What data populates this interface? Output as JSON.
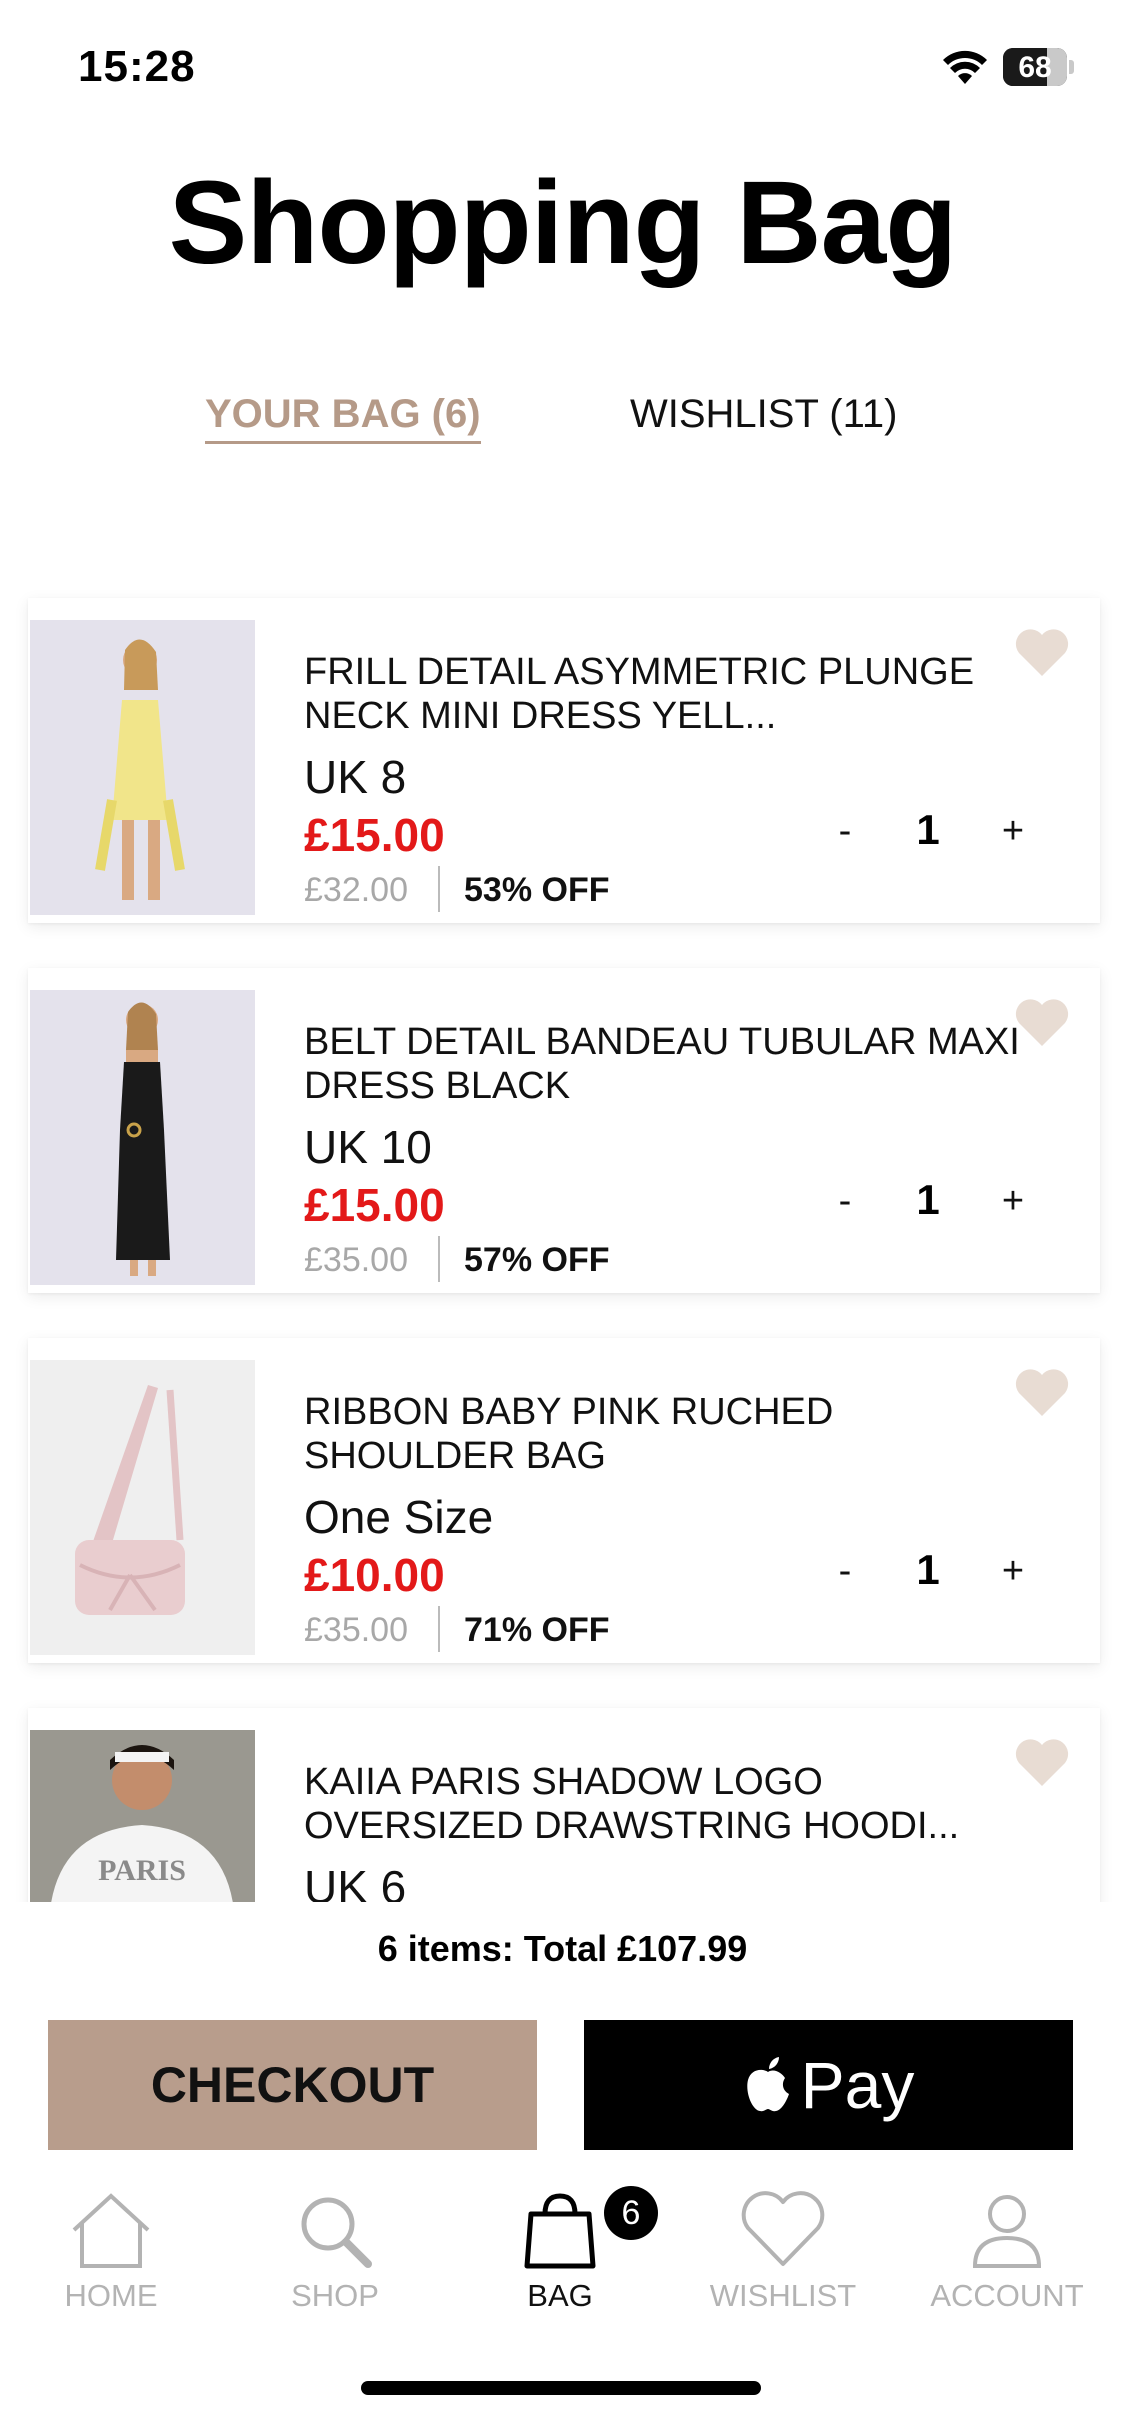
{
  "status_bar": {
    "time": "15:28",
    "battery": "68",
    "battery_level": 0.68
  },
  "page_title": "Shopping Bag",
  "tabs": {
    "bag": "YOUR BAG (6)",
    "wishlist": "WISHLIST (11)"
  },
  "items": [
    {
      "name": "FRILL DETAIL ASYMMETRIC PLUNGE NECK MINI DRESS YELL...",
      "size": "UK 8",
      "price": "£15.00",
      "was": "£32.00",
      "off": "53% OFF",
      "qty": "1",
      "thumb_color": "#f1e58a"
    },
    {
      "name": "BELT DETAIL BANDEAU TUBULAR MAXI DRESS BLACK",
      "size": "UK 10",
      "price": "£15.00",
      "was": "£35.00",
      "off": "57% OFF",
      "qty": "1",
      "thumb_color": "#1a1a1a"
    },
    {
      "name": "RIBBON BABY PINK RUCHED SHOULDER BAG",
      "size": "One Size",
      "price": "£10.00",
      "was": "£35.00",
      "off": "71% OFF",
      "qty": "1",
      "thumb_color": "#e9cdcf"
    },
    {
      "name": "KAIIA PARIS SHADOW LOGO OVERSIZED DRAWSTRING HOODI...",
      "size": "UK 6",
      "price": "",
      "was": "",
      "off": "",
      "qty": "",
      "thumb_color": "#f4f4f4"
    }
  ],
  "qty_controls": {
    "minus": "-",
    "plus": "+"
  },
  "summary": {
    "total": "6 items: Total £107.99"
  },
  "buttons": {
    "checkout": "CHECKOUT",
    "apple_pay": "Pay"
  },
  "nav": {
    "home": "HOME",
    "shop": "SHOP",
    "bag": "BAG",
    "wishlist": "WISHLIST",
    "account": "ACCOUNT",
    "bag_badge": "6"
  },
  "colors": {
    "accent": "#b59a88",
    "sale": "#e31919",
    "heart": "#e8dcd3",
    "checkout_bg": "#b89d8c"
  }
}
